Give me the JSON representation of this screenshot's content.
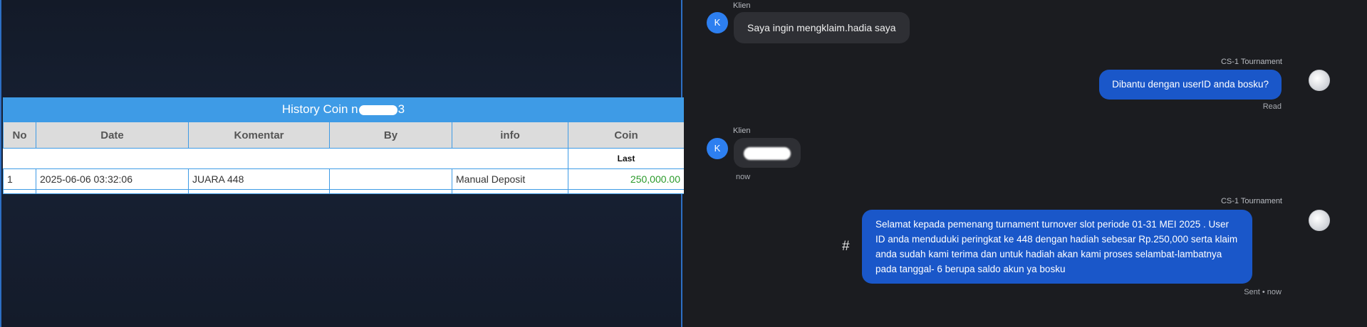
{
  "history": {
    "title_prefix": "History Coin n",
    "title_suffix": "3",
    "columns": [
      "No",
      "Date",
      "Komentar",
      "By",
      "info",
      "Coin"
    ],
    "subheader": "Last",
    "rows": [
      {
        "no": "1",
        "date": "2025-06-06 03:32:06",
        "komentar": "JUARA 448",
        "by": "",
        "info": "Manual Deposit",
        "coin": "250,000.00"
      }
    ],
    "coin_color": "#2a9a2a"
  },
  "chat": {
    "messages": [
      {
        "sender": "Klien",
        "avatar": "K",
        "text": "Saya ingin mengklaim.hadia saya"
      },
      {
        "sender": "CS-1 Tournament",
        "text": "Dibantu dengan userID anda bosku?",
        "status": "Read"
      },
      {
        "sender": "Klien",
        "avatar": "K",
        "text": "",
        "time": "now"
      },
      {
        "sender": "CS-1 Tournament",
        "text": "Selamat kepada pemenang turnament turnover slot periode 01-31 MEI 2025 . User ID anda menduduki peringkat ke 448 dengan hadiah sebesar Rp.250,000 serta klaim anda sudah kami terima dan untuk hadiah akan kami proses selambat-lambatnya pada tanggal- 6 berupa saldo akun ya bosku",
        "status": "Sent • now"
      }
    ],
    "hash_symbol": "#"
  },
  "colors": {
    "accent": "#3e9be6",
    "bubble_out": "#1a57c9",
    "avatar_k": "#2d7ff0"
  }
}
